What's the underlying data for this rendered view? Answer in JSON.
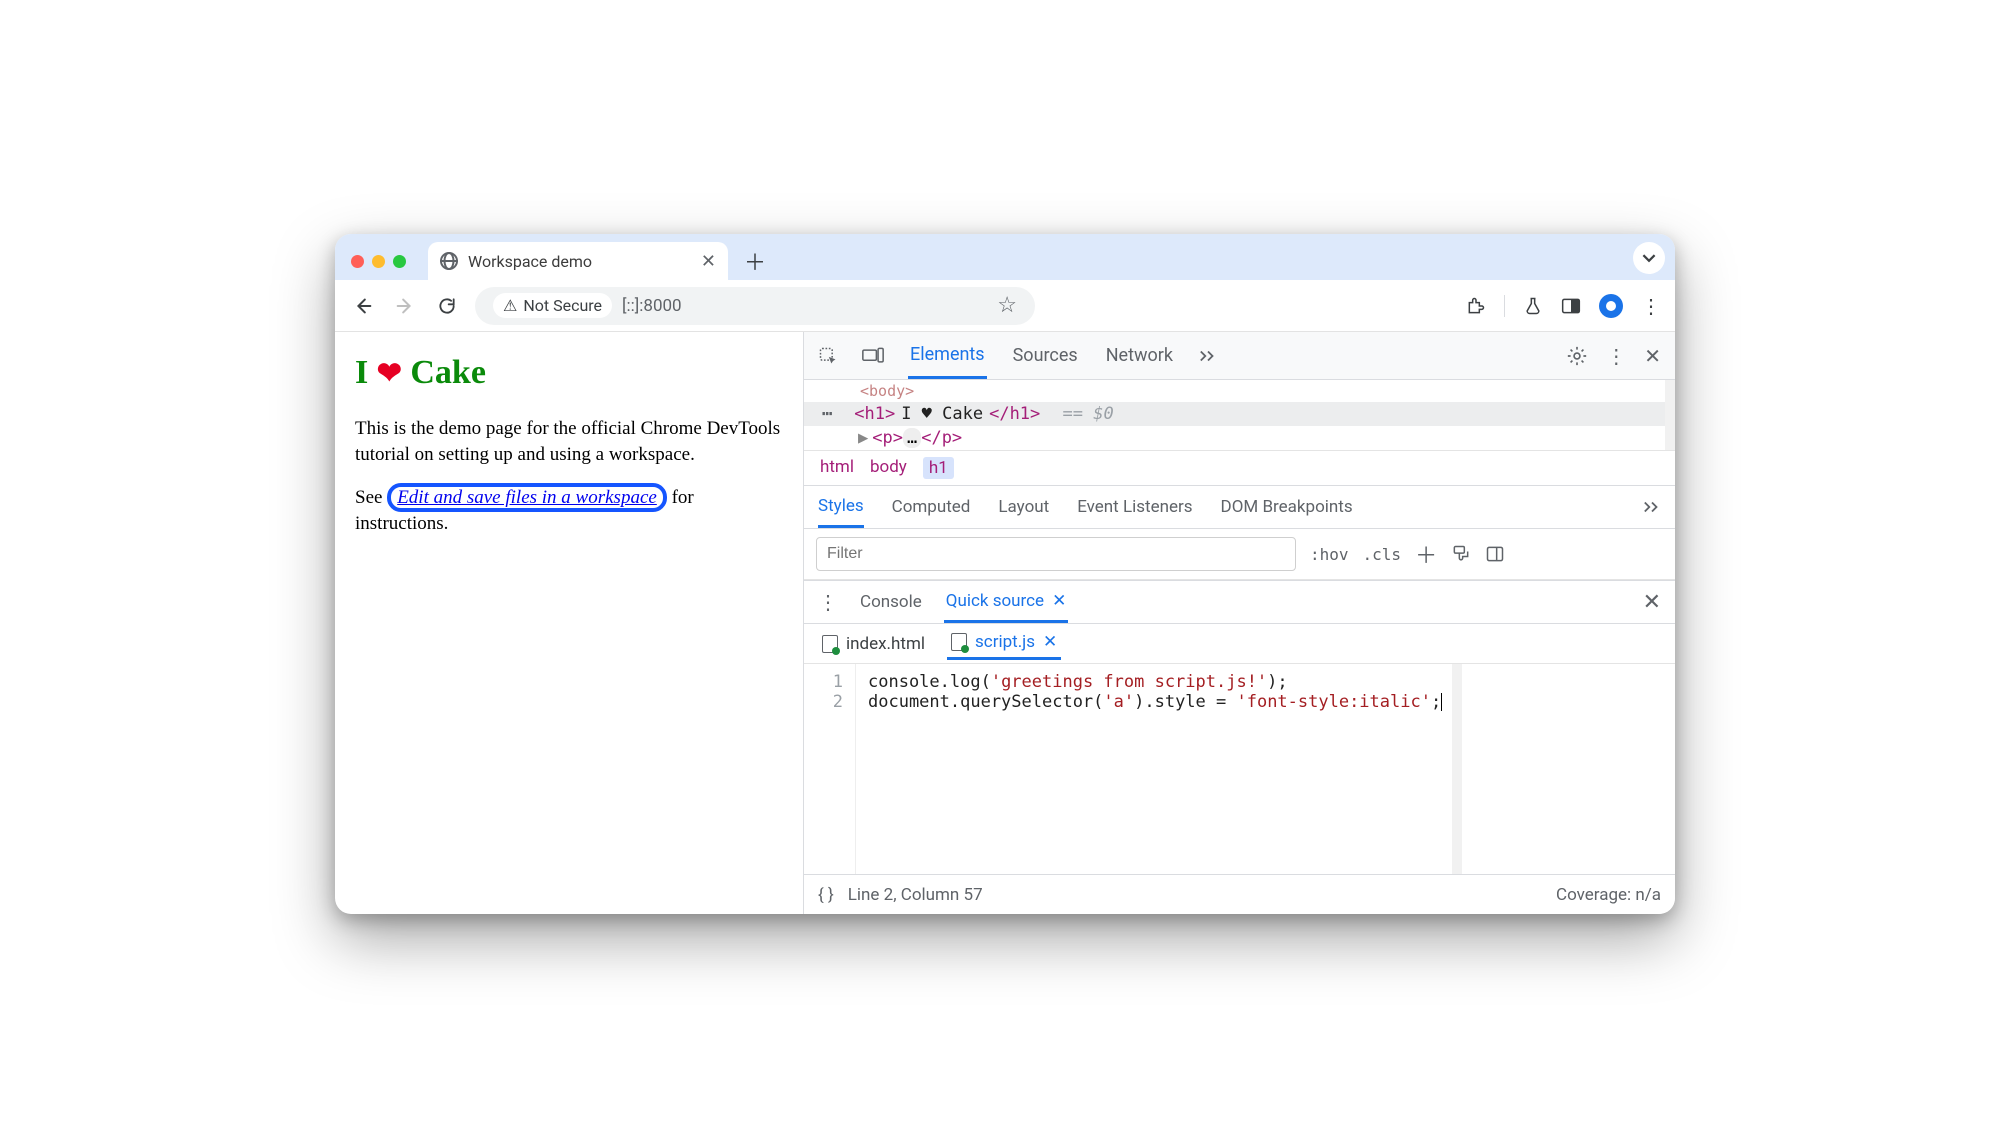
{
  "browser": {
    "tab_title": "Workspace demo",
    "security_label": "Not Secure",
    "url": "[::]:8000"
  },
  "page": {
    "h1_pre": "I ",
    "h1_heart": "❤",
    "h1_post": " Cake",
    "para1": "This is the demo page for the official Chrome DevTools tutorial on setting up and using a workspace.",
    "para2_pre": "See ",
    "link_text": "Edit and save files in a workspace",
    "para2_post": " for instructions."
  },
  "devtools": {
    "tabs": {
      "elements": "Elements",
      "sources": "Sources",
      "network": "Network"
    },
    "elements": {
      "prev_line": "<body>",
      "selected_open": "<h1>",
      "selected_text": "I ♥ Cake",
      "selected_close": "</h1>",
      "eq": "== $0",
      "next_open": "<p>",
      "next_inner": "…",
      "next_close": "</p>",
      "breadcrumbs": {
        "a": "html",
        "b": "body",
        "c": "h1"
      }
    },
    "styles_tabs": {
      "styles": "Styles",
      "computed": "Computed",
      "layout": "Layout",
      "listeners": "Event Listeners",
      "dom": "DOM Breakpoints"
    },
    "filter_placeholder": "Filter",
    "style_tools": {
      "hov": ":hov",
      "cls": ".cls"
    },
    "drawer": {
      "console": "Console",
      "quick": "Quick source"
    },
    "files": {
      "a": "index.html",
      "b": "script.js"
    },
    "code": {
      "ln1": "1",
      "ln2": "2",
      "line1_a": "console.log(",
      "line1_b": "'greetings from script.js!'",
      "line1_c": ");",
      "line2_a": "document.querySelector(",
      "line2_b": "'a'",
      "line2_c": ").style = ",
      "line2_d": "'font-style:italic'",
      "line2_e": ";"
    },
    "status": {
      "pos": "Line 2, Column 57",
      "coverage": "Coverage: n/a"
    }
  }
}
